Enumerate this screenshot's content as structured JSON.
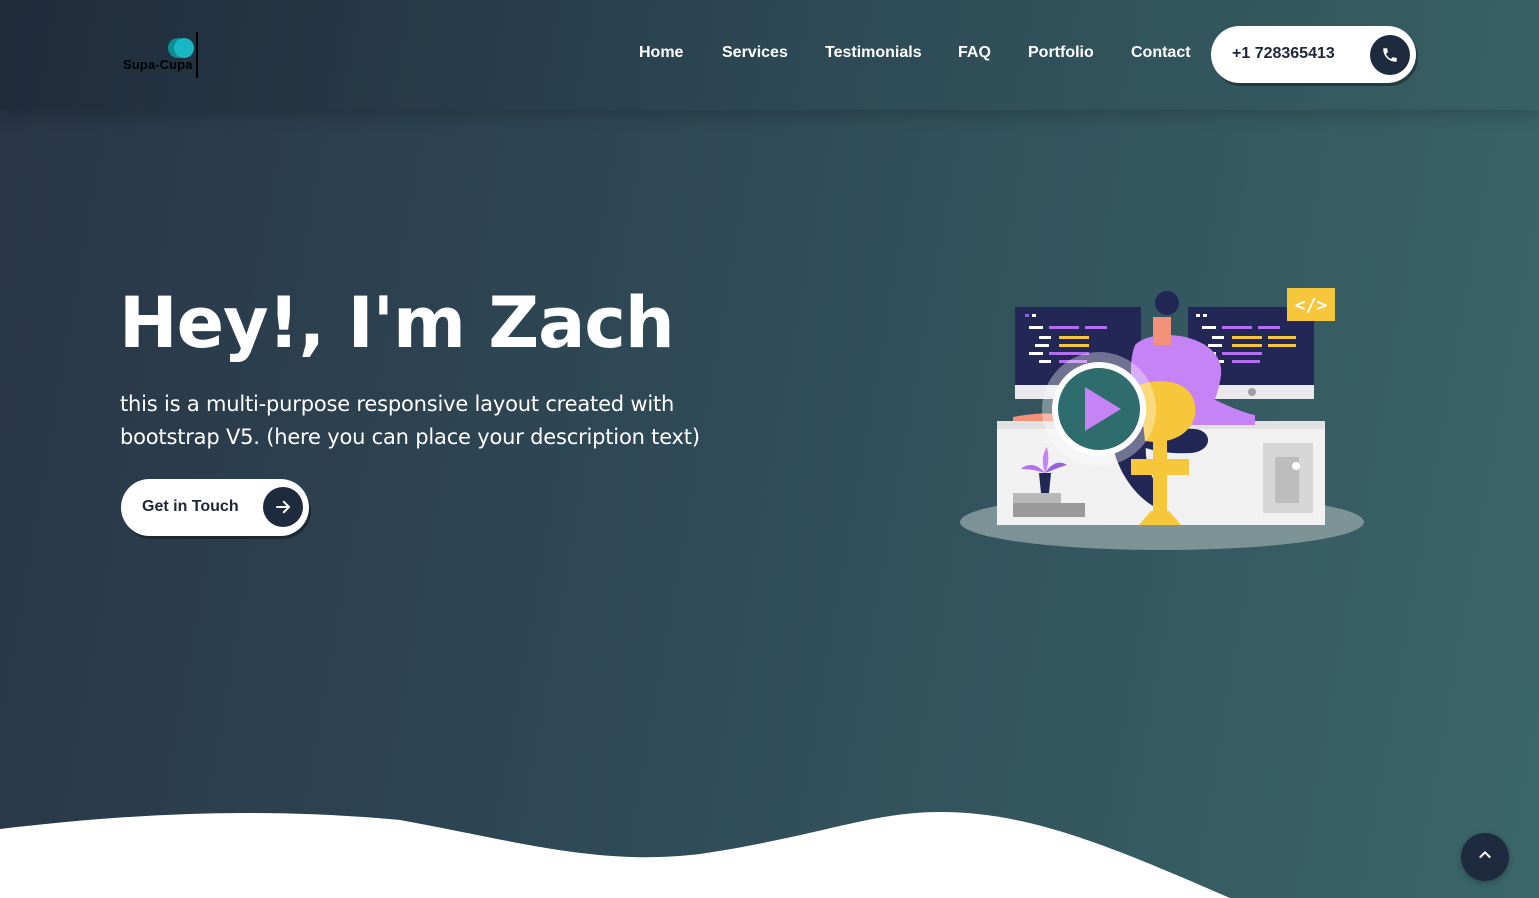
{
  "brand": {
    "logo_text": "Supa-Cupa"
  },
  "nav": {
    "items": [
      {
        "label": "Home"
      },
      {
        "label": "Services"
      },
      {
        "label": "Testimonials"
      },
      {
        "label": "FAQ"
      },
      {
        "label": "Portfolio"
      },
      {
        "label": "Contact"
      }
    ],
    "phone": "+1 728365413",
    "phone_icon": "phone-icon"
  },
  "hero": {
    "title": "Hey!, I'm Zach",
    "description": "this is a multi-purpose responsive layout created with bootstrap V5. (here you can place your description text)",
    "cta_label": "Get in Touch",
    "cta_icon": "arrow-right-icon",
    "illustration_badge": "</>",
    "play_icon": "play-icon"
  },
  "scroll_top_icon": "chevron-up-icon",
  "colors": {
    "dark_navy": "#1e2a3d",
    "accent_teal": "#2f6c6e",
    "accent_purple": "#c583f5",
    "accent_yellow": "#f6c63b"
  }
}
